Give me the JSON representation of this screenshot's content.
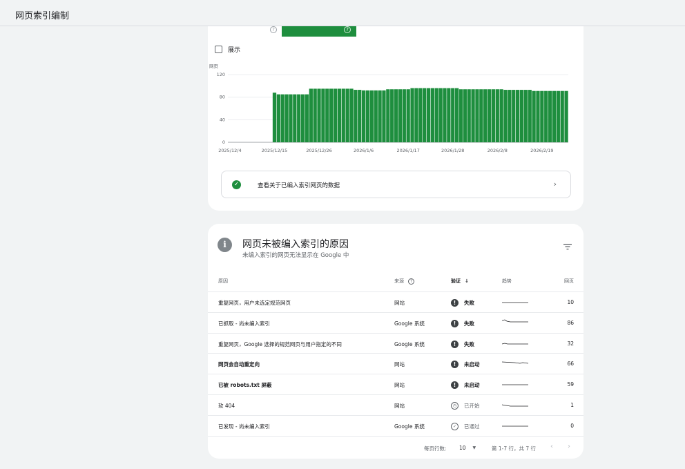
{
  "header": {
    "title": "网页索引编制"
  },
  "tabs": [
    {
      "help_icon": "help-circle-icon"
    },
    {
      "help_icon": "help-circle-icon",
      "active_color": "#1e8e3e"
    }
  ],
  "show_toggle": {
    "label": "展示",
    "checked": false
  },
  "chart_data": {
    "type": "bar",
    "ylabel": "网页",
    "ylim": [
      0,
      120
    ],
    "yticks": [
      0,
      40,
      80,
      120
    ],
    "color": "#1e8e3e",
    "x_tick_labels": [
      "2025/12/4",
      "2025/12/15",
      "2025/12/26",
      "2026/1/6",
      "2026/1/17",
      "2026/1/28",
      "2026/2/8",
      "2026/2/19"
    ],
    "start_date": "2025/12/4",
    "values": [
      0,
      0,
      0,
      0,
      0,
      0,
      0,
      0,
      0,
      0,
      0,
      88,
      85,
      85,
      85,
      85,
      85,
      85,
      85,
      85,
      95,
      95,
      95,
      95,
      95,
      95,
      95,
      95,
      95,
      95,
      95,
      93,
      93,
      92,
      92,
      92,
      92,
      92,
      92,
      94,
      94,
      94,
      94,
      94,
      94,
      96,
      96,
      96,
      96,
      96,
      96,
      96,
      96,
      96,
      96,
      96,
      96,
      94,
      94,
      94,
      94,
      94,
      94,
      94,
      94,
      94,
      94,
      94,
      93,
      93,
      93,
      93,
      93,
      93,
      93,
      91,
      91,
      91,
      91,
      91,
      91,
      91,
      91,
      91
    ]
  },
  "data_link": {
    "text": "查看关于已编入索引网页的数据",
    "icon": "check-circle-icon",
    "chevron": "chevron-right-icon"
  },
  "reasons": {
    "title": "网页未被编入索引的原因",
    "subtitle": "未编入索引的网页无法显示在 Google 中",
    "filter_icon": "filter-icon",
    "columns": {
      "reason": "原因",
      "source": "来源",
      "verify": "验证",
      "trend": "趋势",
      "pages": "网页"
    },
    "rows": [
      {
        "reason": "重复网页，用户未选定规范网页",
        "source": "网站",
        "status": "失败",
        "status_type": "fail",
        "pages": "10",
        "bold": false
      },
      {
        "reason": "已抓取 - 尚未编入索引",
        "source": "Google 系统",
        "status": "失败",
        "status_type": "fail",
        "pages": "86",
        "bold": false
      },
      {
        "reason": "重复网页，Google 选择的规范网页与用户指定的不同",
        "source": "Google 系统",
        "status": "失败",
        "status_type": "fail",
        "pages": "32",
        "bold": false
      },
      {
        "reason": "网页会自动重定向",
        "source": "网站",
        "status": "未启动",
        "status_type": "fail",
        "pages": "66",
        "bold": true
      },
      {
        "reason": "已被 robots.txt 屏蔽",
        "source": "网站",
        "status": "未启动",
        "status_type": "fail",
        "pages": "59",
        "bold": true
      },
      {
        "reason": "软 404",
        "source": "网站",
        "status": "已开始",
        "status_type": "started",
        "pages": "1",
        "bold": false
      },
      {
        "reason": "已发现 - 尚未编入索引",
        "source": "Google 系统",
        "status": "已通过",
        "status_type": "passed",
        "pages": "0",
        "bold": false
      }
    ],
    "pagination": {
      "rows_per_page_label": "每页行数:",
      "rows_per_page": "10",
      "range": "第 1-7 行，共 7 行"
    }
  }
}
